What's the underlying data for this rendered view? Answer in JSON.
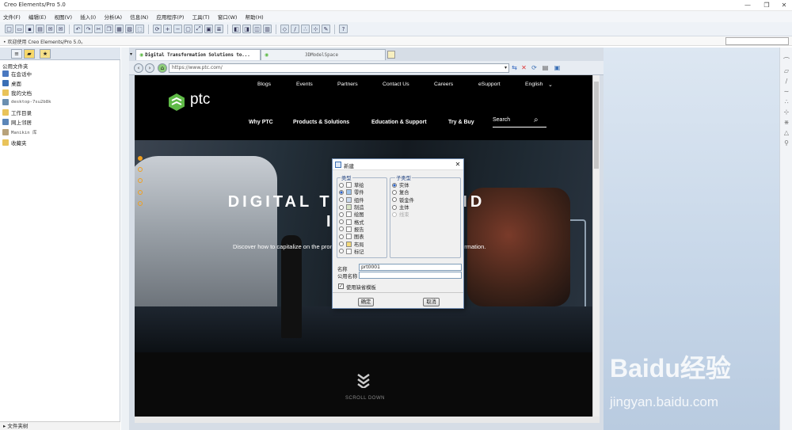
{
  "window": {
    "title": "Creo Elements/Pro 5.0",
    "min": "—",
    "max": "❐",
    "close": "✕"
  },
  "menu": [
    "文件(F)",
    "编辑(E)",
    "视图(V)",
    "插入(I)",
    "分析(A)",
    "信息(N)",
    "应用程序(P)",
    "工具(T)",
    "窗口(W)",
    "帮助(H)"
  ],
  "status": {
    "message": "• 欢迎使用 Creo Elements/Pro 5.0。"
  },
  "nav": {
    "header": "公用文件夹",
    "items": [
      "在会话中",
      "桌面",
      "我的文档",
      "desktop-7su2b8k",
      "工作目录",
      "网上邻居",
      "Manikin 库",
      "收藏夹"
    ],
    "footer": "▸ 文件夹树"
  },
  "browser": {
    "tabs": [
      "Digital Transformation Solutions to...",
      "3DModelSpace"
    ],
    "url": "https://www.ptc.com/"
  },
  "ptc": {
    "topnav": [
      "Blogs",
      "Events",
      "Partners",
      "Contact Us",
      "Careers",
      "eSupport",
      "English"
    ],
    "mainnav": [
      "Why PTC",
      "Products & Solutions",
      "Education & Support",
      "Try & Buy"
    ],
    "logo": "ptc",
    "search": "Search",
    "hero_title_1": "DIGITAL TRAN",
    "hero_title_1b": "AND",
    "hero_title_2": "INNO",
    "hero_sub_a": "Discover how to capitalize on the prom",
    "hero_sub_b": "formation.",
    "scroll": "SCROLL DOWN"
  },
  "dialog": {
    "title": "新建",
    "type_label": "类型",
    "types": [
      "草绘",
      "零件",
      "组件",
      "制造",
      "绘图",
      "格式",
      "报告",
      "图表",
      "布局",
      "标记"
    ],
    "type_selected": 1,
    "subtype_label": "子类型",
    "subtypes": [
      "实体",
      "复合",
      "钣金件",
      "主体",
      "线束"
    ],
    "subtype_selected": 0,
    "name_label": "名称",
    "name_value": "prt0001",
    "common_name_label": "公用名称",
    "common_name_value": "",
    "use_template": "使用缺省模板",
    "ok": "确定",
    "cancel": "取消"
  },
  "watermark": {
    "brand": "Baidu经验",
    "url": "jingyan.baidu.com"
  },
  "colors": {
    "ptc_green": "#5fba47",
    "dialog_border": "#6f8bb0",
    "accent_orange": "#f0a020"
  }
}
